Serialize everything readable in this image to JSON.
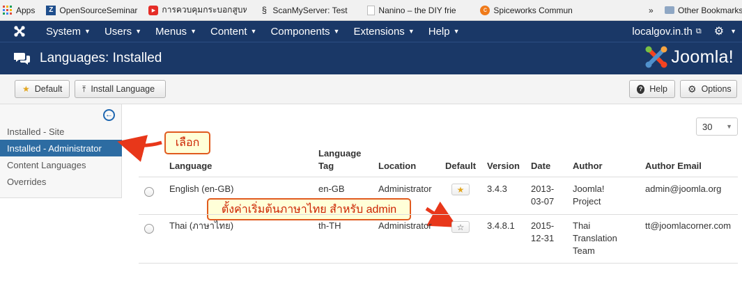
{
  "bookmarks": {
    "items": [
      {
        "label": "Apps",
        "icon": "apps-grid-icon",
        "color": "#e04a3a"
      },
      {
        "label": "OpenSourceSeminar",
        "icon": "z-logo-icon",
        "color": "#1f4e8c"
      },
      {
        "label": "การควบคุมกระบอกสูบห",
        "icon": "youtube-icon",
        "color": "#e52d27"
      },
      {
        "label": "ScanMyServer: Test",
        "icon": "scanmyserver-icon",
        "color": "#2a2a2a"
      },
      {
        "label": "Nanino – the DIY frie",
        "icon": "page-icon",
        "color": "#d8d8d8"
      },
      {
        "label": "Spiceworks Commun",
        "icon": "spiceworks-icon",
        "color": "#ef7a1a"
      }
    ],
    "more": "»",
    "other": "Other Bookmarks"
  },
  "topnav": {
    "menus": [
      "System",
      "Users",
      "Menus",
      "Content",
      "Components",
      "Extensions",
      "Help"
    ],
    "site": "localgov.in.th"
  },
  "header": {
    "title": "Languages: Installed",
    "brand": "Joomla!"
  },
  "toolbar": {
    "default_label": "Default",
    "install_label": "Install Language",
    "help_label": "Help",
    "options_label": "Options"
  },
  "sidebar": {
    "items": [
      "Installed - Site",
      "Installed - Administrator",
      "Content Languages",
      "Overrides"
    ],
    "active_index": 1
  },
  "callouts": {
    "select": "เลือก",
    "default_admin": "ตั้งค่าเริ่มต้นภาษาไทย สำหรับ admin"
  },
  "list": {
    "limit": "30",
    "headers": {
      "language": "Language",
      "tag_1": "Language",
      "tag_2": "Tag",
      "location": "Location",
      "default": "Default",
      "version": "Version",
      "date": "Date",
      "author": "Author",
      "email": "Author Email"
    },
    "rows": [
      {
        "language": "English (en-GB)",
        "tag": "en-GB",
        "location": "Administrator",
        "is_default": true,
        "version": "3.4.3",
        "date_1": "2013-",
        "date_2": "03-07",
        "author_1": "Joomla!",
        "author_2": "Project",
        "author_3": "",
        "email": "admin@joomla.org"
      },
      {
        "language": "Thai (ภาษาไทย)",
        "tag": "th-TH",
        "location": "Administrator",
        "is_default": false,
        "version": "3.4.8.1",
        "date_1": "2015-",
        "date_2": "12-31",
        "author_1": "Thai",
        "author_2": "Translation",
        "author_3": "Team",
        "email": "tt@joomlacorner.com"
      }
    ]
  },
  "colors": {
    "nav_bg": "#1a3867",
    "sidebar_active": "#2d6ca2",
    "callout_border": "#e05a1e",
    "callout_text": "#cc2200",
    "star_gold": "#e2a51e"
  }
}
